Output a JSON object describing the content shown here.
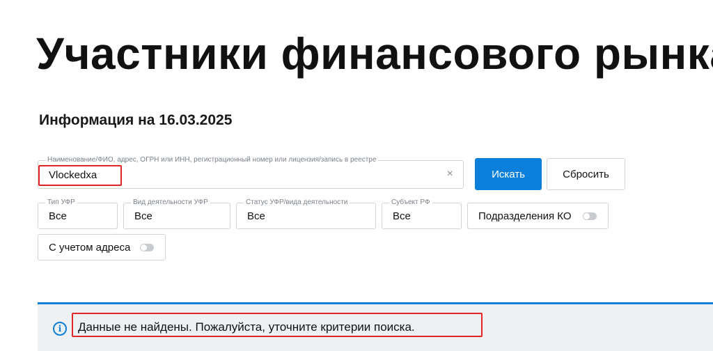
{
  "page": {
    "title": "Участники финансового рынка",
    "info_date": "Информация на 16.03.2025"
  },
  "search": {
    "label": "Наименование/ФИО, адрес, ОГРН или ИНН, регистрационный номер или лицензия/запись в реестре",
    "value": "Vlockedxa",
    "clear_icon": "×",
    "search_button": "Искать",
    "reset_button": "Сбросить"
  },
  "filters": {
    "type": {
      "label": "Тип УФР",
      "value": "Все"
    },
    "activity": {
      "label": "Вид деятельности УФР",
      "value": "Все"
    },
    "status": {
      "label": "Статус УФР/вида деятельности",
      "value": "Все"
    },
    "region": {
      "label": "Субъект РФ",
      "value": "Все"
    },
    "ko_divisions": {
      "label": "Подразделения КО",
      "enabled": false
    },
    "with_address": {
      "label": "С учетом адреса",
      "enabled": false
    }
  },
  "notice": {
    "icon": "info-icon",
    "icon_glyph": "i",
    "text": "Данные не найдены. Пожалуйста, уточните критерии поиска."
  },
  "colors": {
    "accent": "#0b7fd9",
    "highlight": "#e32424",
    "notice_bg": "#eef1f4"
  }
}
